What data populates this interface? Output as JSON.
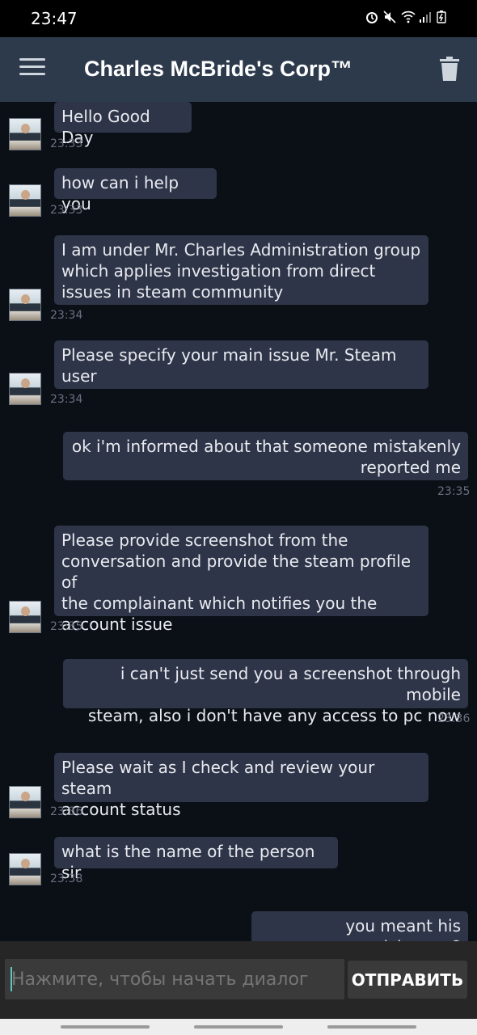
{
  "status_bar": {
    "time": "23:47",
    "icons": [
      "alarm-icon",
      "mute-icon",
      "wifi-icon",
      "signal-icon",
      "battery-icon"
    ]
  },
  "app_bar": {
    "title": "Charles McBride's Corp™",
    "menu_icon": "hamburger-menu-icon",
    "delete_icon": "trash-icon"
  },
  "messages": [
    {
      "side": "in",
      "lines": [
        "Hello Good Day"
      ],
      "time": "23:33"
    },
    {
      "side": "in",
      "lines": [
        "how can i help you"
      ],
      "time": "23:33"
    },
    {
      "side": "in",
      "lines": [
        "I am under Mr. Charles Administration group",
        "which applies investigation from direct",
        "issues in steam community"
      ],
      "time": "23:34"
    },
    {
      "side": "in",
      "lines": [
        "Please specify your main issue Mr. Steam",
        "user"
      ],
      "time": "23:34"
    },
    {
      "side": "out",
      "lines": [
        "ok i'm informed about that someone mistakenly",
        "reported me"
      ],
      "time": "23:35"
    },
    {
      "side": "in",
      "lines": [
        "Please provide screenshot from the",
        "conversation and provide the steam profile of",
        "the complainant which notifies you the",
        "account issue"
      ],
      "time": "23:35"
    },
    {
      "side": "out",
      "lines": [
        "i can't just send you a screenshot through mobile",
        "steam, also i don't have any access to pc now"
      ],
      "time": "23:36"
    },
    {
      "side": "in",
      "lines": [
        "Please wait as I check and review your steam",
        "account status"
      ],
      "time": "23:36"
    },
    {
      "side": "in",
      "lines": [
        "what is the name of the person sir"
      ],
      "time": "23:38"
    },
    {
      "side": "out",
      "lines": [
        "you meant his nickname?"
      ],
      "time": ""
    }
  ],
  "composer": {
    "placeholder": "Нажмите, чтобы начать диалог",
    "send_label": "ОТПРАВИТЬ"
  },
  "colors": {
    "app_bar": "#2d3a4c",
    "chat_background": "#0b1017",
    "bubble": "#2f3548",
    "timestamp": "#6a7080"
  }
}
